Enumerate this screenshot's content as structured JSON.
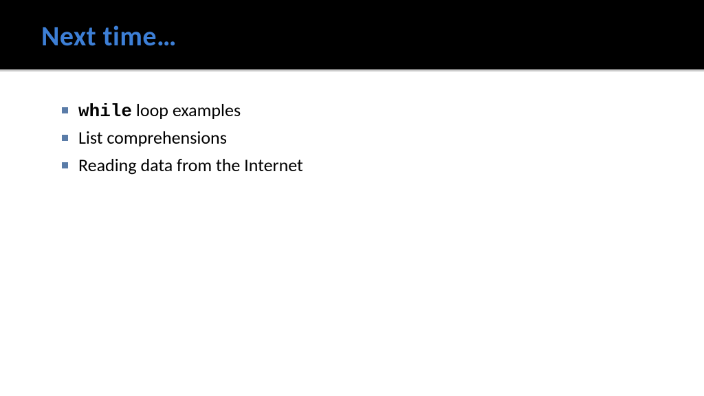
{
  "header": {
    "title": "Next time…"
  },
  "content": {
    "items": [
      {
        "code": "while",
        "text": " loop examples"
      },
      {
        "code": "",
        "text": "List comprehensions"
      },
      {
        "code": "",
        "text": "Reading data from the Internet"
      }
    ]
  }
}
